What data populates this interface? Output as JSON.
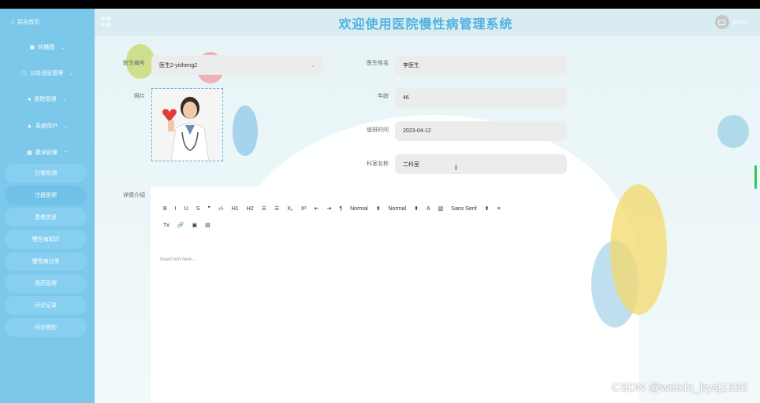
{
  "header": {
    "home_label": "后台首页",
    "title": "欢迎使用医院慢性病管理系统",
    "user": "admin"
  },
  "sidebar": {
    "items": [
      {
        "label": "轮播图",
        "icon": "image-icon"
      },
      {
        "label": "公告消息管理",
        "icon": "info-icon"
      },
      {
        "label": "医院管理",
        "icon": "location-icon"
      },
      {
        "label": "系统用户",
        "icon": "user-icon"
      },
      {
        "label": "模块管理",
        "icon": "grid-icon"
      }
    ],
    "subitems": [
      "日常检测",
      "注册医师",
      "患者信息",
      "慢性病知识",
      "慢性病分类",
      "用药管理",
      "问诊记录",
      "问诊预约"
    ]
  },
  "form": {
    "doctor_id_label": "医生编号",
    "doctor_id_value": "医生2-yisheng2",
    "doctor_name_label": "医生姓名",
    "doctor_name_value": "李医生",
    "photo_label": "照片",
    "age_label": "年龄",
    "age_value": "46",
    "time_label": "值班时间",
    "time_value": "2023-04-12",
    "dept_label": "科室名称",
    "dept_value": "二科室",
    "detail_label": "详情介绍"
  },
  "editor": {
    "toolbar_row1": [
      "B",
      "I",
      "U",
      "S",
      "❞",
      "‹/›",
      "H1",
      "H2",
      "☰",
      "☰",
      "X₂",
      "X²",
      "⇤",
      "⇥",
      "¶",
      "Normal",
      "⬍",
      "Normal",
      "⬍",
      "A",
      "▧",
      "Sans Serif",
      "⬍",
      "≡"
    ],
    "toolbar_row2": [
      "Tx",
      "🔗",
      "▣",
      "▤"
    ],
    "placeholder": "Insert text here ..."
  },
  "watermark": "CSDN @weixin_bysj1330"
}
